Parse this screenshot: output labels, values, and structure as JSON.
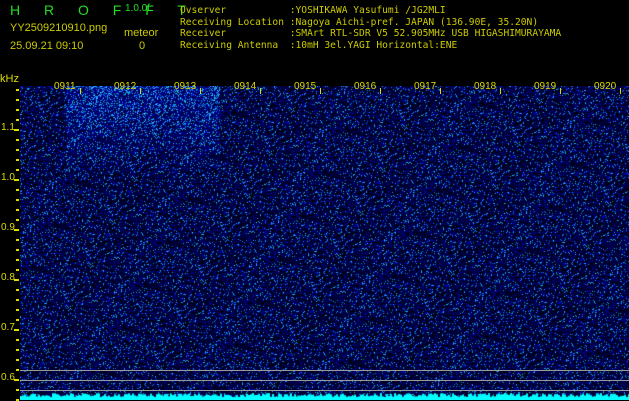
{
  "header": {
    "logo": "H R O F F T",
    "version": "1.0.0f",
    "filename": "YY2509210910.png",
    "datetime": "25.09.21 09:10",
    "meteor_label": "meteor",
    "meteor_count": "0",
    "info_lines": [
      "Ovserver           :YOSHIKAWA Yasufumi /JG2MLI",
      "Receiving Location :Nagoya Aichi-pref. JAPAN (136.90E, 35.20N)",
      "Receiver           :SMArt RTL-SDR V5 52.905MHz USB HIGASHIMURAYAMA",
      "Receiving Antenna  :10mH 3el.YAGI Horizontal:ENE"
    ]
  },
  "spectrogram": {
    "y_unit": "kHz",
    "y_ticks": [
      "1.1",
      "1.0",
      "0.9",
      "0.8",
      "0.7",
      "0.6"
    ],
    "x_ticks": [
      "0911",
      "0912",
      "0913",
      "0914",
      "0915",
      "0916",
      "0917",
      "0918",
      "0919",
      "0920"
    ],
    "colors": {
      "background": "#000000",
      "signal": "#2030ff",
      "label": "#dddd00",
      "spectrum": "#00ffff"
    }
  }
}
